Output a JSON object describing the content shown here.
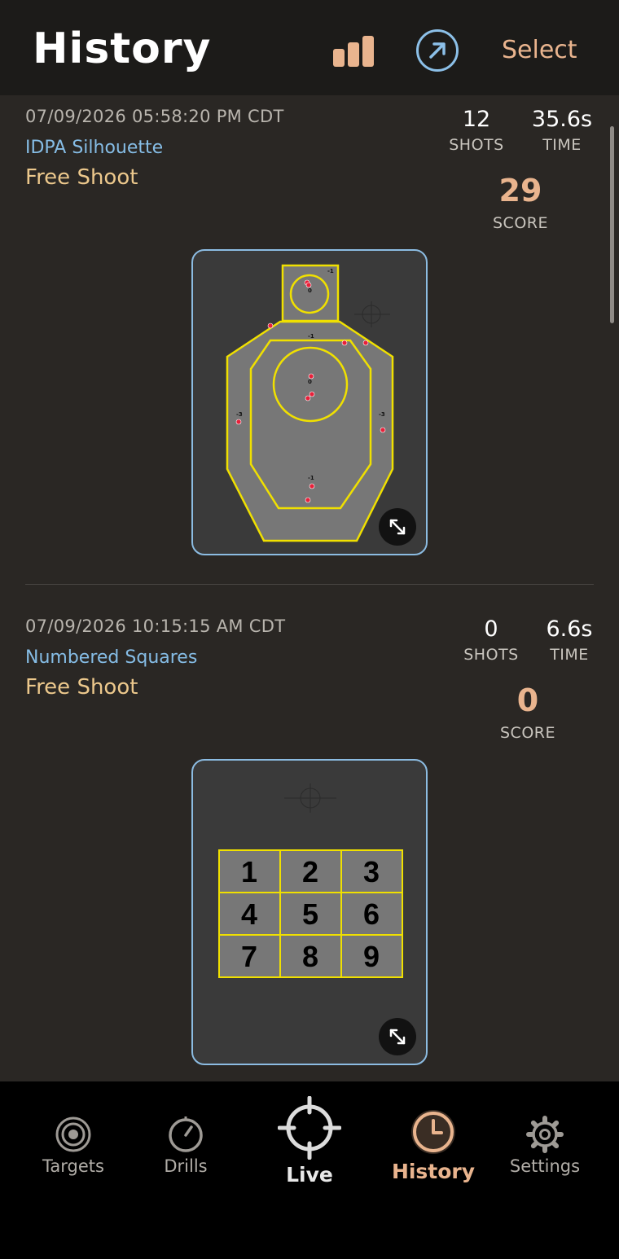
{
  "header": {
    "title": "History",
    "select_label": "Select"
  },
  "sessions": [
    {
      "datetime": "07/09/2026 05:58:20 PM CDT",
      "target": "IDPA Silhouette",
      "mode": "Free Shoot",
      "shots": "12",
      "shots_label": "SHOTS",
      "time": "35.6s",
      "time_label": "TIME",
      "score": "29",
      "score_label": "SCORE",
      "zone_labels": [
        "-1",
        "0",
        "-1",
        "0",
        "-3",
        "-3",
        "-1"
      ]
    },
    {
      "datetime": "07/09/2026 10:15:15 AM CDT",
      "target": "Numbered Squares",
      "mode": "Free Shoot",
      "shots": "0",
      "shots_label": "SHOTS",
      "time": "6.6s",
      "time_label": "TIME",
      "score": "0",
      "score_label": "SCORE",
      "squares": [
        "1",
        "2",
        "3",
        "4",
        "5",
        "6",
        "7",
        "8",
        "9"
      ]
    }
  ],
  "tabs": [
    {
      "label": "Targets",
      "icon": "target-icon"
    },
    {
      "label": "Drills",
      "icon": "timer-icon"
    },
    {
      "label": "Live",
      "icon": "crosshair-icon"
    },
    {
      "label": "History",
      "icon": "clock-icon"
    },
    {
      "label": "Settings",
      "icon": "gear-icon"
    }
  ],
  "colors": {
    "accent": "#e9b48e",
    "link_blue": "#86bde6",
    "mode_gold": "#ecc88c",
    "target_yellow": "#f0e000",
    "hit_red": "#e8203a"
  }
}
